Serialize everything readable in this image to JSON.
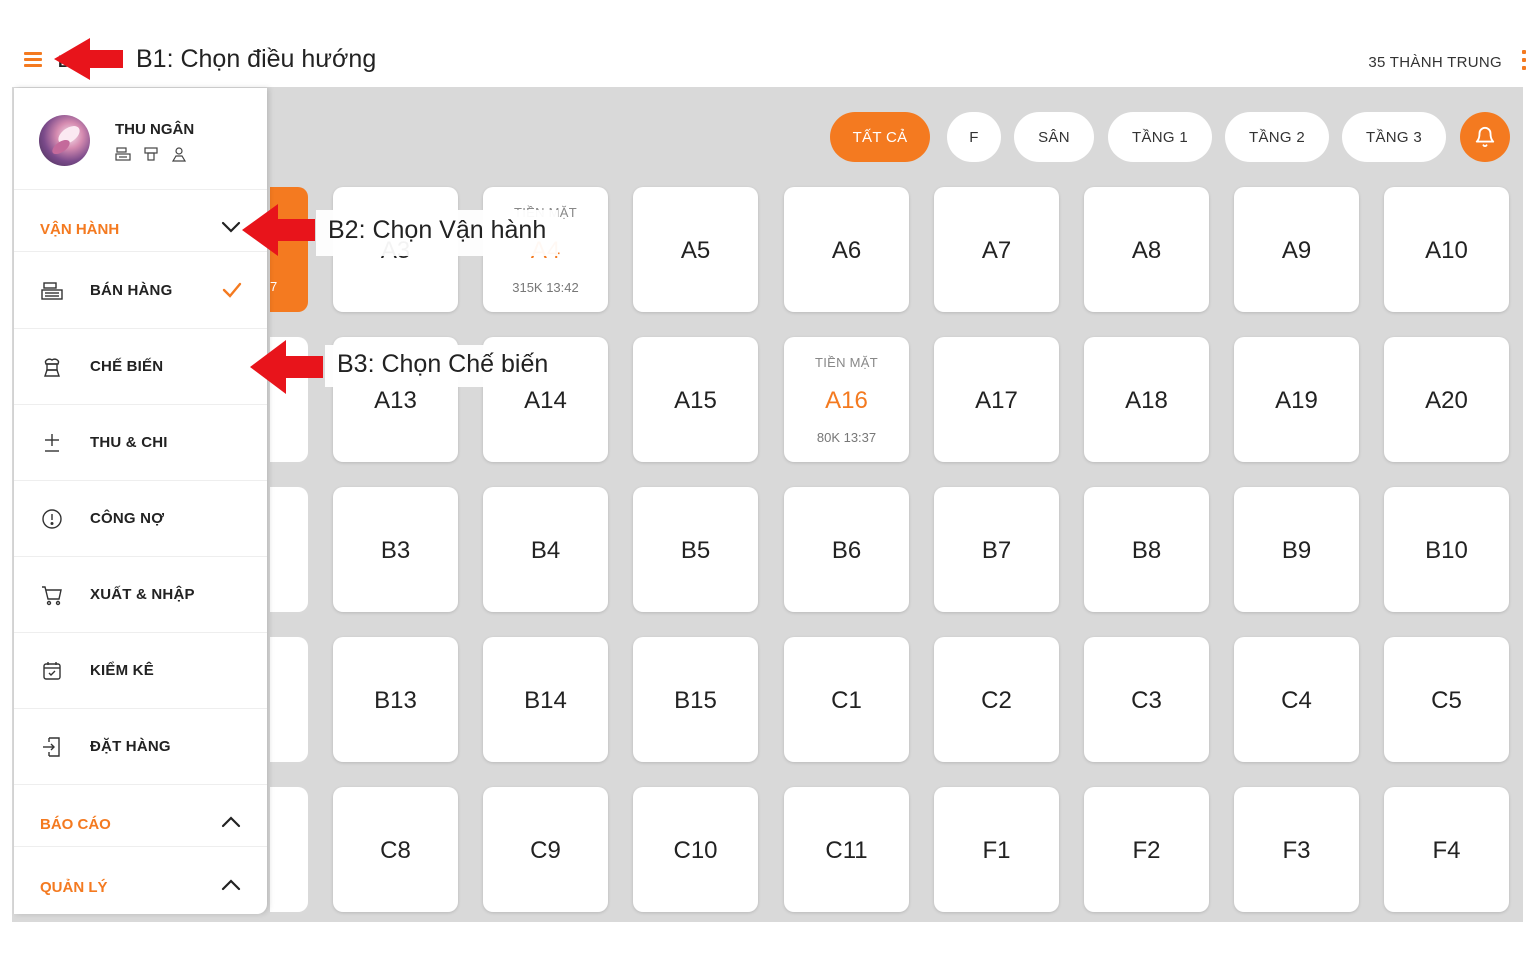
{
  "topbar": {
    "brand_letter": "B",
    "store_name": "35 THÀNH TRUNG"
  },
  "filters": [
    {
      "label": "TẤT CẢ",
      "active": true
    },
    {
      "label": "F",
      "active": false
    },
    {
      "label": "SÂN",
      "active": false
    },
    {
      "label": "TẦNG 1",
      "active": false
    },
    {
      "label": "TẦNG 2",
      "active": false
    },
    {
      "label": "TẦNG 3",
      "active": false
    }
  ],
  "tables": {
    "row1": [
      {
        "name": "A3",
        "top": "",
        "bottom": ""
      },
      {
        "name": "A4",
        "top": "TIỀN MẶT",
        "bottom": "315K 13:42",
        "busy": true
      },
      {
        "name": "A5"
      },
      {
        "name": "A6"
      },
      {
        "name": "A7"
      },
      {
        "name": "A8"
      },
      {
        "name": "A9"
      },
      {
        "name": "A10"
      }
    ],
    "row2": [
      {
        "name": "A13"
      },
      {
        "name": "A14"
      },
      {
        "name": "A15"
      },
      {
        "name": "A16",
        "top": "TIỀN MẶT",
        "bottom": "80K 13:37",
        "busy": true
      },
      {
        "name": "A17"
      },
      {
        "name": "A18"
      },
      {
        "name": "A19"
      },
      {
        "name": "A20"
      }
    ],
    "row3": [
      {
        "name": "B3"
      },
      {
        "name": "B4"
      },
      {
        "name": "B5"
      },
      {
        "name": "B6"
      },
      {
        "name": "B7"
      },
      {
        "name": "B8"
      },
      {
        "name": "B9"
      },
      {
        "name": "B10"
      }
    ],
    "row4": [
      {
        "name": "B13"
      },
      {
        "name": "B14"
      },
      {
        "name": "B15"
      },
      {
        "name": "C1"
      },
      {
        "name": "C2"
      },
      {
        "name": "C3"
      },
      {
        "name": "C4"
      },
      {
        "name": "C5"
      }
    ],
    "row5": [
      {
        "name": "C8"
      },
      {
        "name": "C9"
      },
      {
        "name": "C10"
      },
      {
        "name": "C11"
      },
      {
        "name": "F1"
      },
      {
        "name": "F2"
      },
      {
        "name": "F3"
      },
      {
        "name": "F4"
      }
    ],
    "edge_note": "7"
  },
  "sidemenu": {
    "user_name": "THU NGÂN",
    "section_operation": "VẬN HÀNH",
    "items": [
      {
        "label": "BÁN HÀNG",
        "icon": "cash-register-icon",
        "selected": true
      },
      {
        "label": "CHẾ BIẾN",
        "icon": "chef-icon"
      },
      {
        "label": "THU & CHI",
        "icon": "plus-minus-icon"
      },
      {
        "label": "CÔNG NỢ",
        "icon": "alert-circle-icon"
      },
      {
        "label": "XUẤT & NHẬP",
        "icon": "cart-icon"
      },
      {
        "label": "KIỂM KÊ",
        "icon": "calendar-check-icon"
      },
      {
        "label": "ĐẶT HÀNG",
        "icon": "login-icon"
      }
    ],
    "section_report": "BÁO CÁO",
    "section_manage": "QUẢN LÝ"
  },
  "annotations": {
    "b1": "B1: Chọn điều hướng",
    "b2": "B2: Chọn Vận hành",
    "b3": "B3: Chọn Chế biến"
  },
  "colors": {
    "accent": "#f47a20",
    "background": "#d9d9d9",
    "arrow": "#e8141b"
  }
}
